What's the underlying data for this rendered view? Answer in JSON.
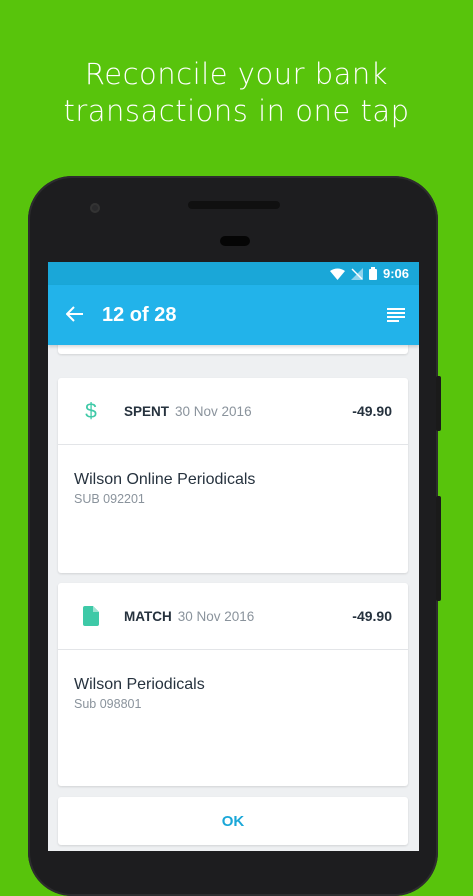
{
  "headline": {
    "line1": "Reconcile your bank",
    "line2": "transactions in one tap"
  },
  "status_bar": {
    "time": "9:06",
    "icons": [
      "wifi-icon",
      "no-signal-icon",
      "battery-icon"
    ]
  },
  "app_bar": {
    "title": "12 of 28",
    "back_icon": "arrow-left-icon",
    "menu_icon": "list-icon"
  },
  "statement_card": {
    "icon": "dollar-icon",
    "tag": "SPENT",
    "date": "30 Nov 2016",
    "amount": "-49.90",
    "payee": "Wilson Online Periodicals",
    "reference": "SUB 092201"
  },
  "match_card": {
    "icon": "document-icon",
    "tag": "MATCH",
    "date": "30 Nov 2016",
    "amount": "-49.90",
    "payee": "Wilson Periodicals",
    "reference": "Sub 098801"
  },
  "ok_button": {
    "label": "OK"
  },
  "colors": {
    "background": "#58c40c",
    "app_bar": "#22b3ea",
    "status_bar": "#1aa7d8",
    "accent": "#3ec9a7"
  }
}
